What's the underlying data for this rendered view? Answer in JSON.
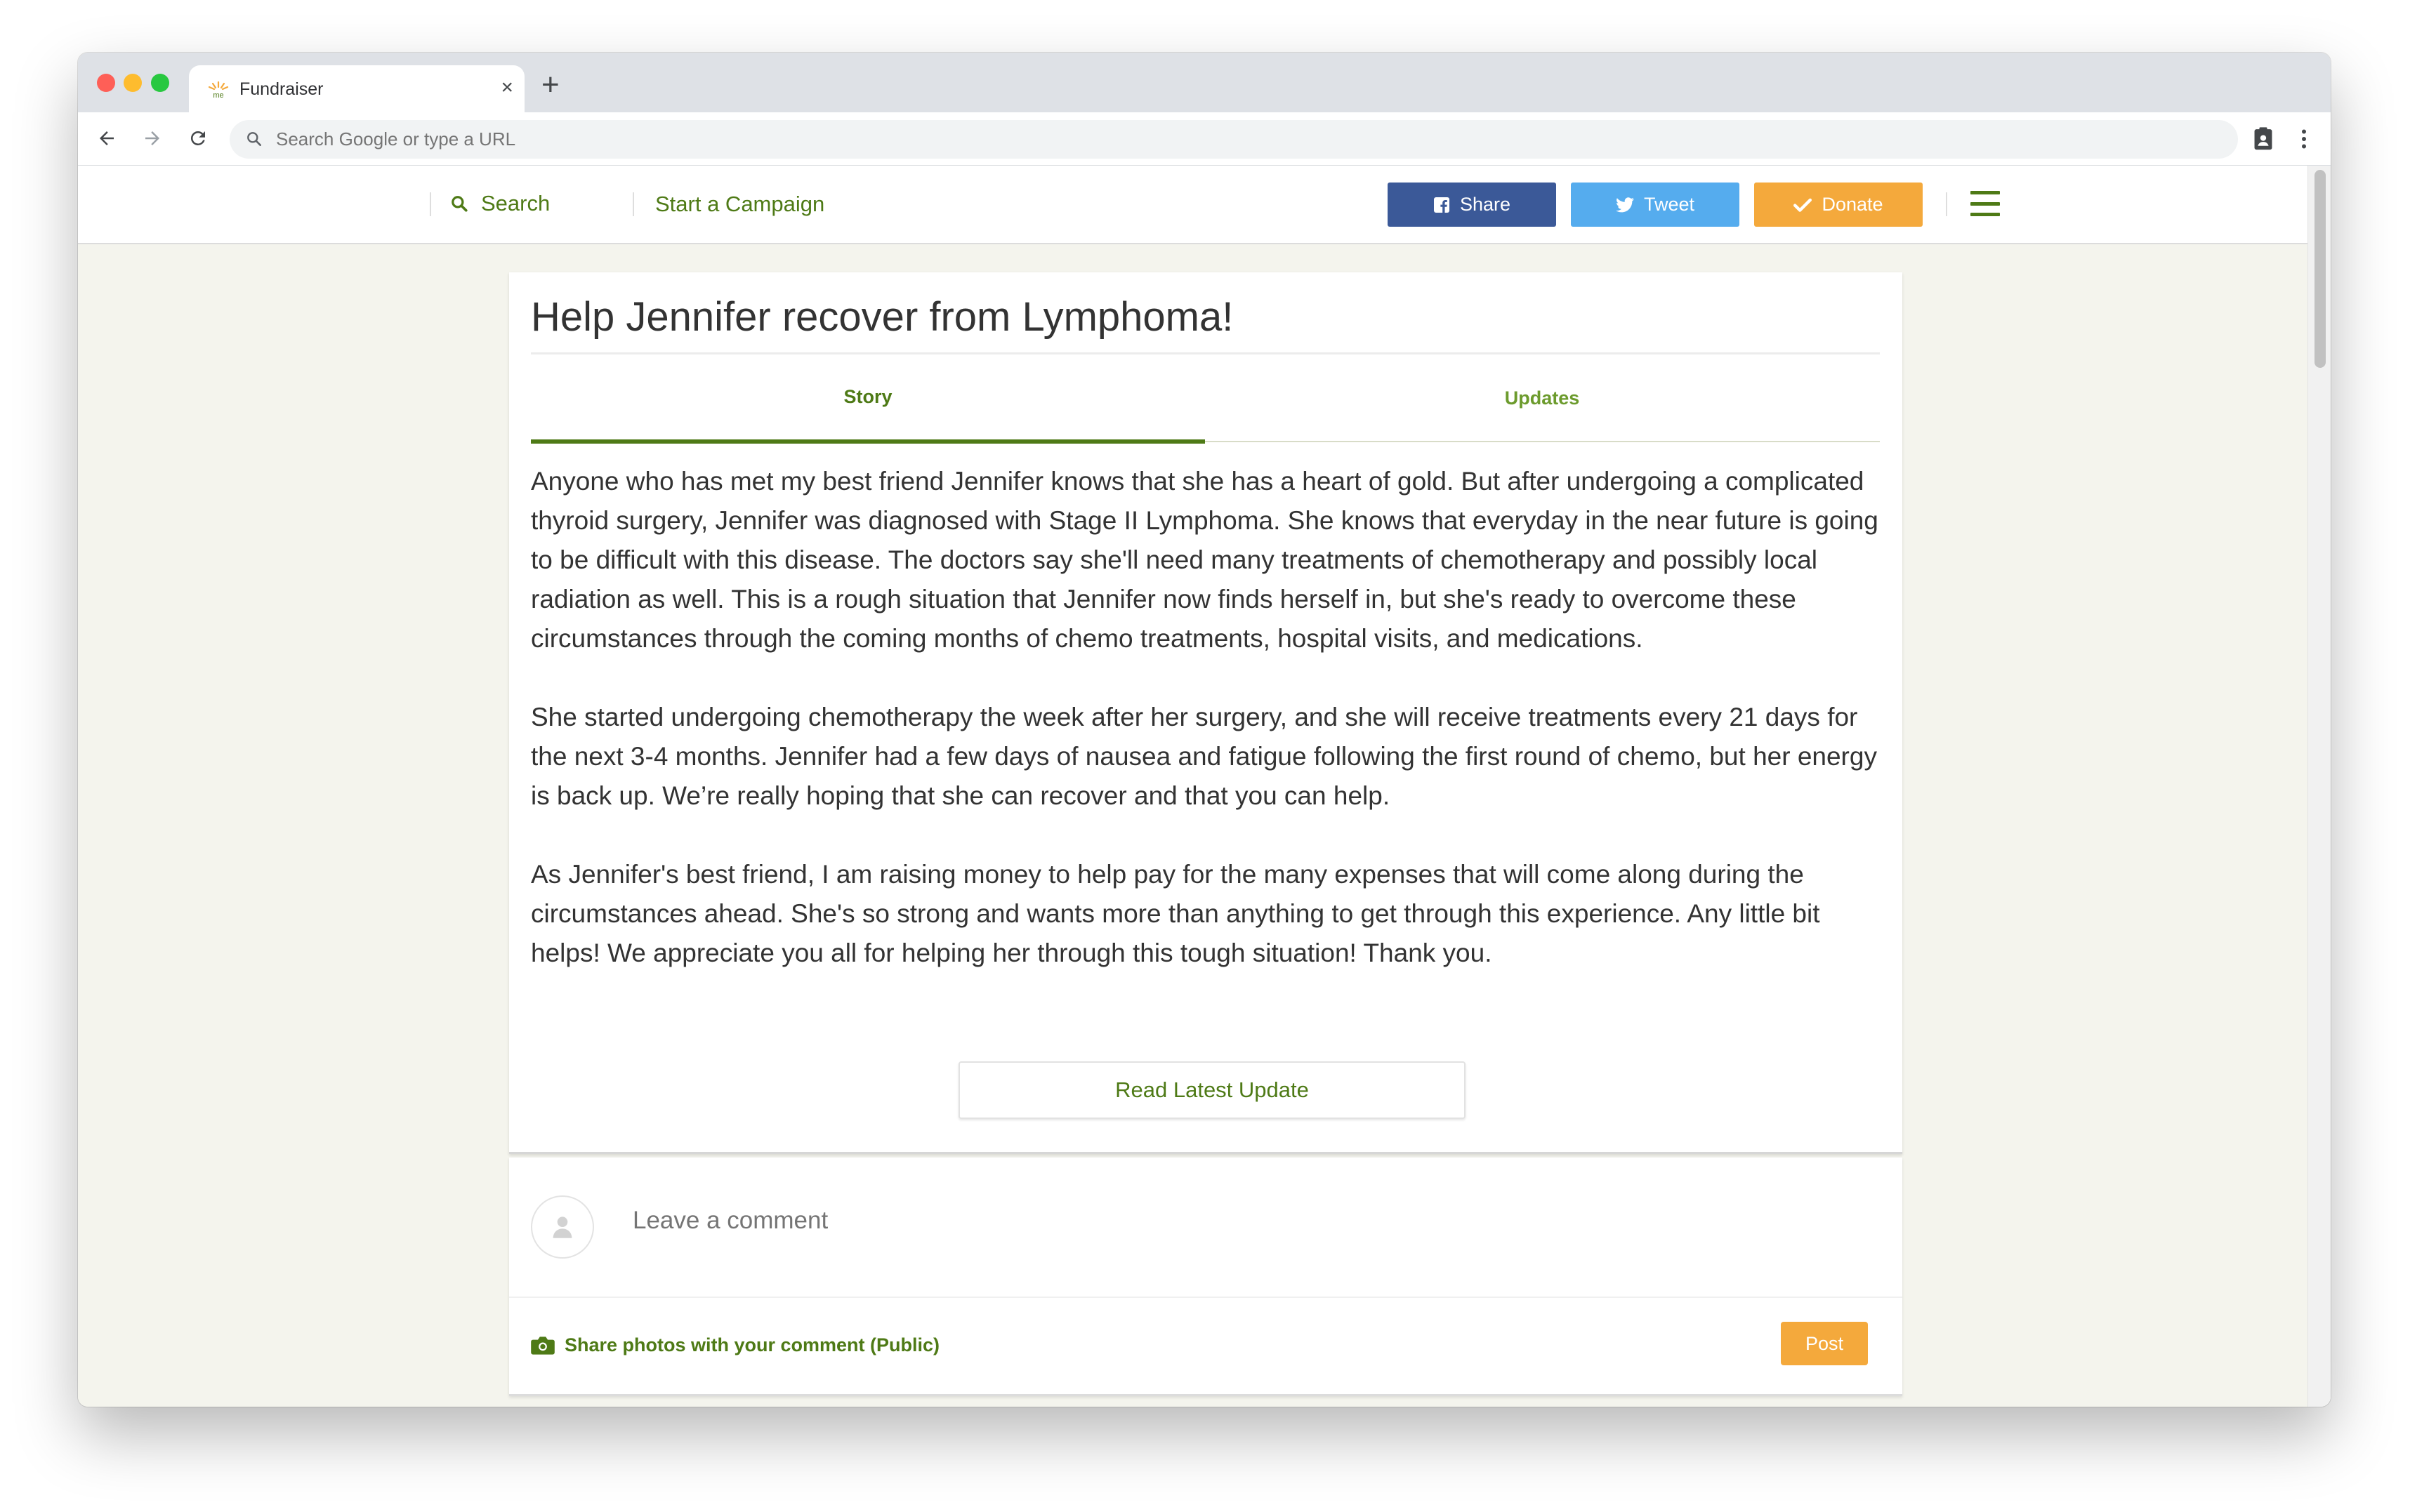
{
  "browser": {
    "tab_title": "Fundraiser",
    "tab_favicon_text": "me",
    "new_tab_glyph": "+",
    "close_glyph": "×",
    "address_placeholder": "Search Google or type a URL"
  },
  "header": {
    "search_label": "Search",
    "start_campaign_label": "Start a Campaign",
    "share_label": "Share",
    "tweet_label": "Tweet",
    "donate_label": "Donate",
    "colors": {
      "brand_green": "#4e7a16",
      "facebook": "#3b5998",
      "twitter": "#55acee",
      "donate": "#f4a93c"
    }
  },
  "campaign": {
    "title": "Help Jennifer recover from Lymphoma!",
    "tabs": [
      {
        "label": "Story",
        "active": true
      },
      {
        "label": "Updates",
        "active": false
      }
    ],
    "story_paragraphs": [
      "Anyone who has met my best friend Jennifer knows that she has a heart of gold. But after undergoing a complicated thyroid surgery, Jennifer was diagnosed with Stage II Lymphoma. She knows that everyday in the near future is going to be difficult with this disease. The doctors say she'll need many treatments of chemotherapy and possibly local radiation as well. This is a rough situation that Jennifer now finds herself in, but she's ready to overcome these circumstances through the coming months of chemo treatments, hospital visits, and medications.",
      "She started undergoing chemotherapy the week after her surgery, and she will receive treatments every 21 days for the next 3-4 months. Jennifer had a few days of nausea and fatigue following the first round of chemo, but her energy is back up. We’re really hoping that she can recover and that you can help.",
      "As Jennifer's best friend, I am raising money to help pay for the many expenses that will come along during the circumstances ahead. She's so strong and wants more than anything to get through this experience. Any little bit helps! We appreciate you all for helping her through this tough situation! Thank you."
    ],
    "read_update_label": "Read Latest Update"
  },
  "comments": {
    "placeholder": "Leave a comment",
    "share_photos_label": "Share photos with your comment (Public)",
    "post_label": "Post"
  }
}
